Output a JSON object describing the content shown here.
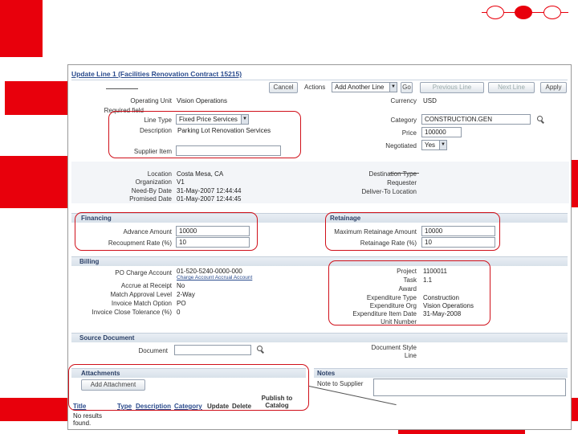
{
  "header": {
    "page_title": "Update Line 1 (Facilities Renovation Contract 15215)"
  },
  "toolbar": {
    "cancel_label": "Cancel",
    "actions_label": "Actions",
    "actions_value": "Add Another Line",
    "go_label": "Go",
    "previous_label": "Previous Line",
    "next_label": "Next Line",
    "apply_label": "Apply"
  },
  "line_info": {
    "operating_unit_label": "Operating Unit",
    "operating_unit_value": "Vision Operations",
    "required_note": "Required field",
    "line_type_label": "Line Type",
    "line_type_value": "Fixed Price Services",
    "description_label": "Description",
    "description_value": "Parking Lot Renovation Services",
    "supplier_item_label": "Supplier Item",
    "currency_label": "Currency",
    "currency_value": "USD",
    "category_label": "Category",
    "category_value": "CONSTRUCTION.GEN",
    "price_label": "Price",
    "price_value": "100000",
    "negotiated_label": "Negotiated",
    "negotiated_value": "Yes"
  },
  "shipment": {
    "location_label": "Location",
    "location_value": "Costa Mesa, CA",
    "org_label": "Organization",
    "org_value": "V1",
    "need_by_label": "Need-By Date",
    "need_by_value": "31-May-2007 12:44:44",
    "promised_label": "Promised Date",
    "promised_value": "01-May-2007 12:44:45",
    "dest_type_label": "Destination Type",
    "requester_label": "Requester",
    "deliver_to_label": "Deliver-To Location"
  },
  "financing": {
    "title": "Financing",
    "advance_label": "Advance Amount",
    "advance_value": "10000",
    "recoupment_label": "Recoupment Rate (%)",
    "recoupment_value": "10"
  },
  "retainage": {
    "title": "Retainage",
    "max_label": "Maximum Retainage Amount",
    "max_value": "10000",
    "rate_label": "Retainage Rate (%)",
    "rate_value": "10"
  },
  "billing": {
    "title": "Billing",
    "po_charge_label": "PO Charge Account",
    "po_charge_value": "01-520-5240-0000-000",
    "po_charge_links": "Charge Account  Accrual Account",
    "accrue_label": "Accrue at Receipt",
    "accrue_value": "No",
    "match_label": "Match Approval Level",
    "match_value": "2-Way",
    "invoice_match_label": "Invoice Match Option",
    "invoice_match_value": "PO",
    "tolerance_label": "Invoice Close Tolerance (%)",
    "tolerance_value": "0",
    "project_label": "Project",
    "project_value": "1100011",
    "task_label": "Task",
    "task_value": "1.1",
    "award_label": "Award",
    "expenditure_type_label": "Expenditure Type",
    "expenditure_type_value": "Construction",
    "exp_org_label": "Expenditure Org",
    "exp_org_value": "Vision Operations",
    "exp_date_label": "Expenditure Item Date",
    "exp_date_value": "31-May-2008",
    "unit_number_label": "Unit Number"
  },
  "source_doc": {
    "title": "Source Document",
    "document_label": "Document",
    "doc_style_label": "Document Style",
    "doc_line_label": "Line"
  },
  "attachments": {
    "title": "Attachments",
    "add_label": "Add Attachment",
    "columns": {
      "title": "Title",
      "type": "Type",
      "description": "Description",
      "category": "Category",
      "update": "Update",
      "delete": "Delete",
      "publish": "Publish to Catalog"
    },
    "empty_text": "No results found."
  },
  "notes": {
    "title": "Notes",
    "note_label": "Note to Supplier"
  },
  "colors": {
    "accent_red": "#e8000c",
    "link_blue": "#2a4b8d"
  }
}
